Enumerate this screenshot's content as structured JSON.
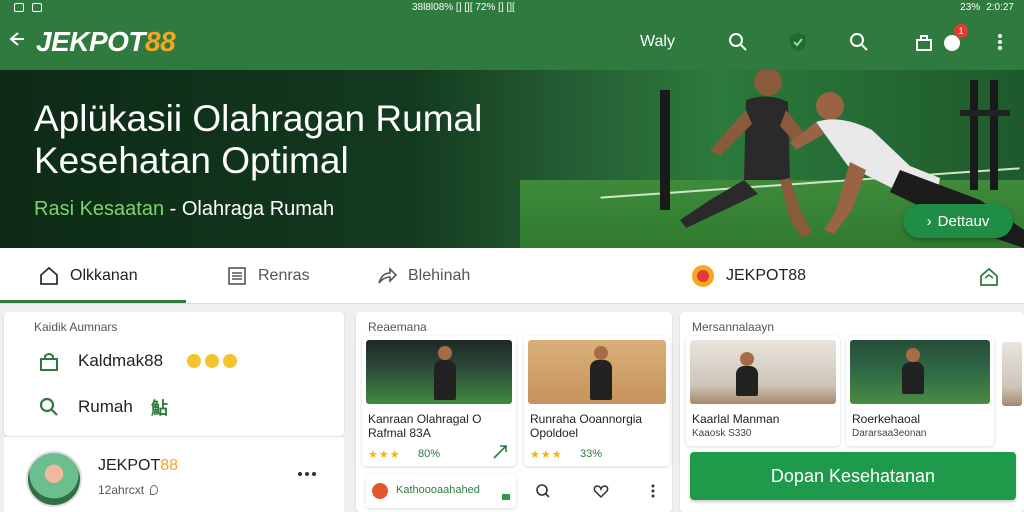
{
  "status_bar": {
    "left_icons": [
      "image-icon",
      "gallery-icon"
    ],
    "center_text": "38l8l08% [] [][ 72% [] [][",
    "right_text": "23%",
    "time": "2:0:27"
  },
  "app_bar": {
    "brand_prefix": "JEKPOT",
    "brand_suffix": "88",
    "action_label": "Waly",
    "notification_count": "1",
    "icons": [
      "back-arrow-icon",
      "search-icon",
      "shield-check-icon",
      "search-icon",
      "bag-icon",
      "notification-icon",
      "more-vertical-icon"
    ]
  },
  "hero": {
    "title": "Aplükasii Olahragan Rumal Kesehatan Optimal",
    "subtitle_accent": "Rasi Kesaatan",
    "subtitle_separator": " - ",
    "subtitle_rest": "Olahraga Rumah",
    "cta_label": "Dettauv"
  },
  "tabs": [
    {
      "label": "Olkkanan",
      "icon": "home-icon",
      "active": true
    },
    {
      "label": "Renras",
      "icon": "list-icon",
      "active": false
    },
    {
      "label": "Blehinah",
      "icon": "share-icon",
      "active": false
    }
  ],
  "tab_brand": {
    "label": "JEKPOT88",
    "logo": "brand-logo-icon",
    "right_icon": "home-outline-icon"
  },
  "left_panel": {
    "title": "Kaidik Aumnars",
    "items": [
      {
        "label": "Kaldmak88",
        "icon": "lock-icon"
      },
      {
        "label": "Rumah",
        "icon": "search-icon",
        "suffix": "鮎"
      }
    ]
  },
  "profile": {
    "name_prefix": "JEKPOT",
    "name_suffix": "88",
    "meta": "12ahrcxt",
    "more_icon": "more-horizontal-icon"
  },
  "middle_panel": {
    "title": "Reaemana",
    "cards": [
      {
        "caption_line1": "Kanraan Olahragal O",
        "caption_line2": "Rafmal 83A",
        "stars": "★★★",
        "rating": "80%",
        "icon": "trend-icon"
      },
      {
        "caption_line1": "Runraha Ooannorgia",
        "caption_line2": "Opoldoel",
        "stars": "★★★",
        "rating": "33%",
        "icon": ""
      }
    ],
    "mini_card": {
      "label": "Kathoooaahahed",
      "icon": "app-badge-icon"
    },
    "actions": [
      "search-icon",
      "heart-icon",
      "more-vertical-icon"
    ]
  },
  "right_panel": {
    "title": "Mersannalaayn",
    "cards": [
      {
        "caption_line1": "Kaarlal Manman",
        "caption_line2": "Kaaosk S330"
      },
      {
        "caption_line1": "Roerkehaoal",
        "caption_line2": "Dararsaa3eonan"
      }
    ],
    "button_label": "Dopan Kesehatanan"
  },
  "colors": {
    "primary": "#2f7a3e",
    "accent": "#f5a623",
    "button": "#1f9a4a",
    "star": "#f4b400"
  }
}
